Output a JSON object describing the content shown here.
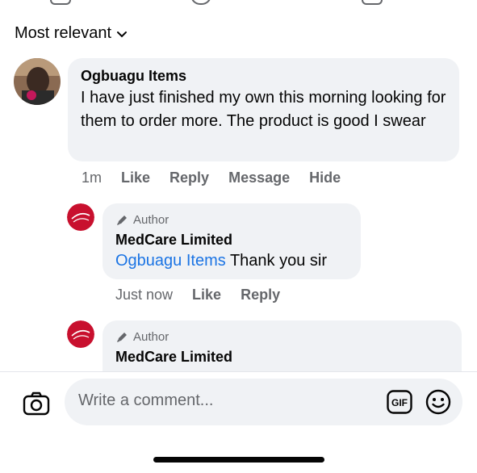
{
  "sort": {
    "label": "Most relevant",
    "chevron_icon": "chevron-down-icon"
  },
  "comments": [
    {
      "author": "Ogbuagu Items",
      "text": "I have just finished my own this morning looking for them to order more. The product is good I swear",
      "time": "1m",
      "actions": [
        "Like",
        "Reply",
        "Message",
        "Hide"
      ]
    }
  ],
  "replies": [
    {
      "badge": "Author",
      "author": "MedCare Limited",
      "mention": "Ogbuagu Items",
      "text": " Thank you sir",
      "time": "Just now",
      "actions": [
        "Like",
        "Reply"
      ]
    },
    {
      "badge": "Author",
      "author": "MedCare Limited"
    }
  ],
  "composer": {
    "placeholder": "Write a comment...",
    "gif_label": "GIF",
    "camera_icon": "camera-icon",
    "emoji_icon": "emoji-icon"
  },
  "colors": {
    "link": "#1b74e4",
    "bubble": "#f0f2f5",
    "muted": "#65676b",
    "brand_red": "#c8102e"
  }
}
